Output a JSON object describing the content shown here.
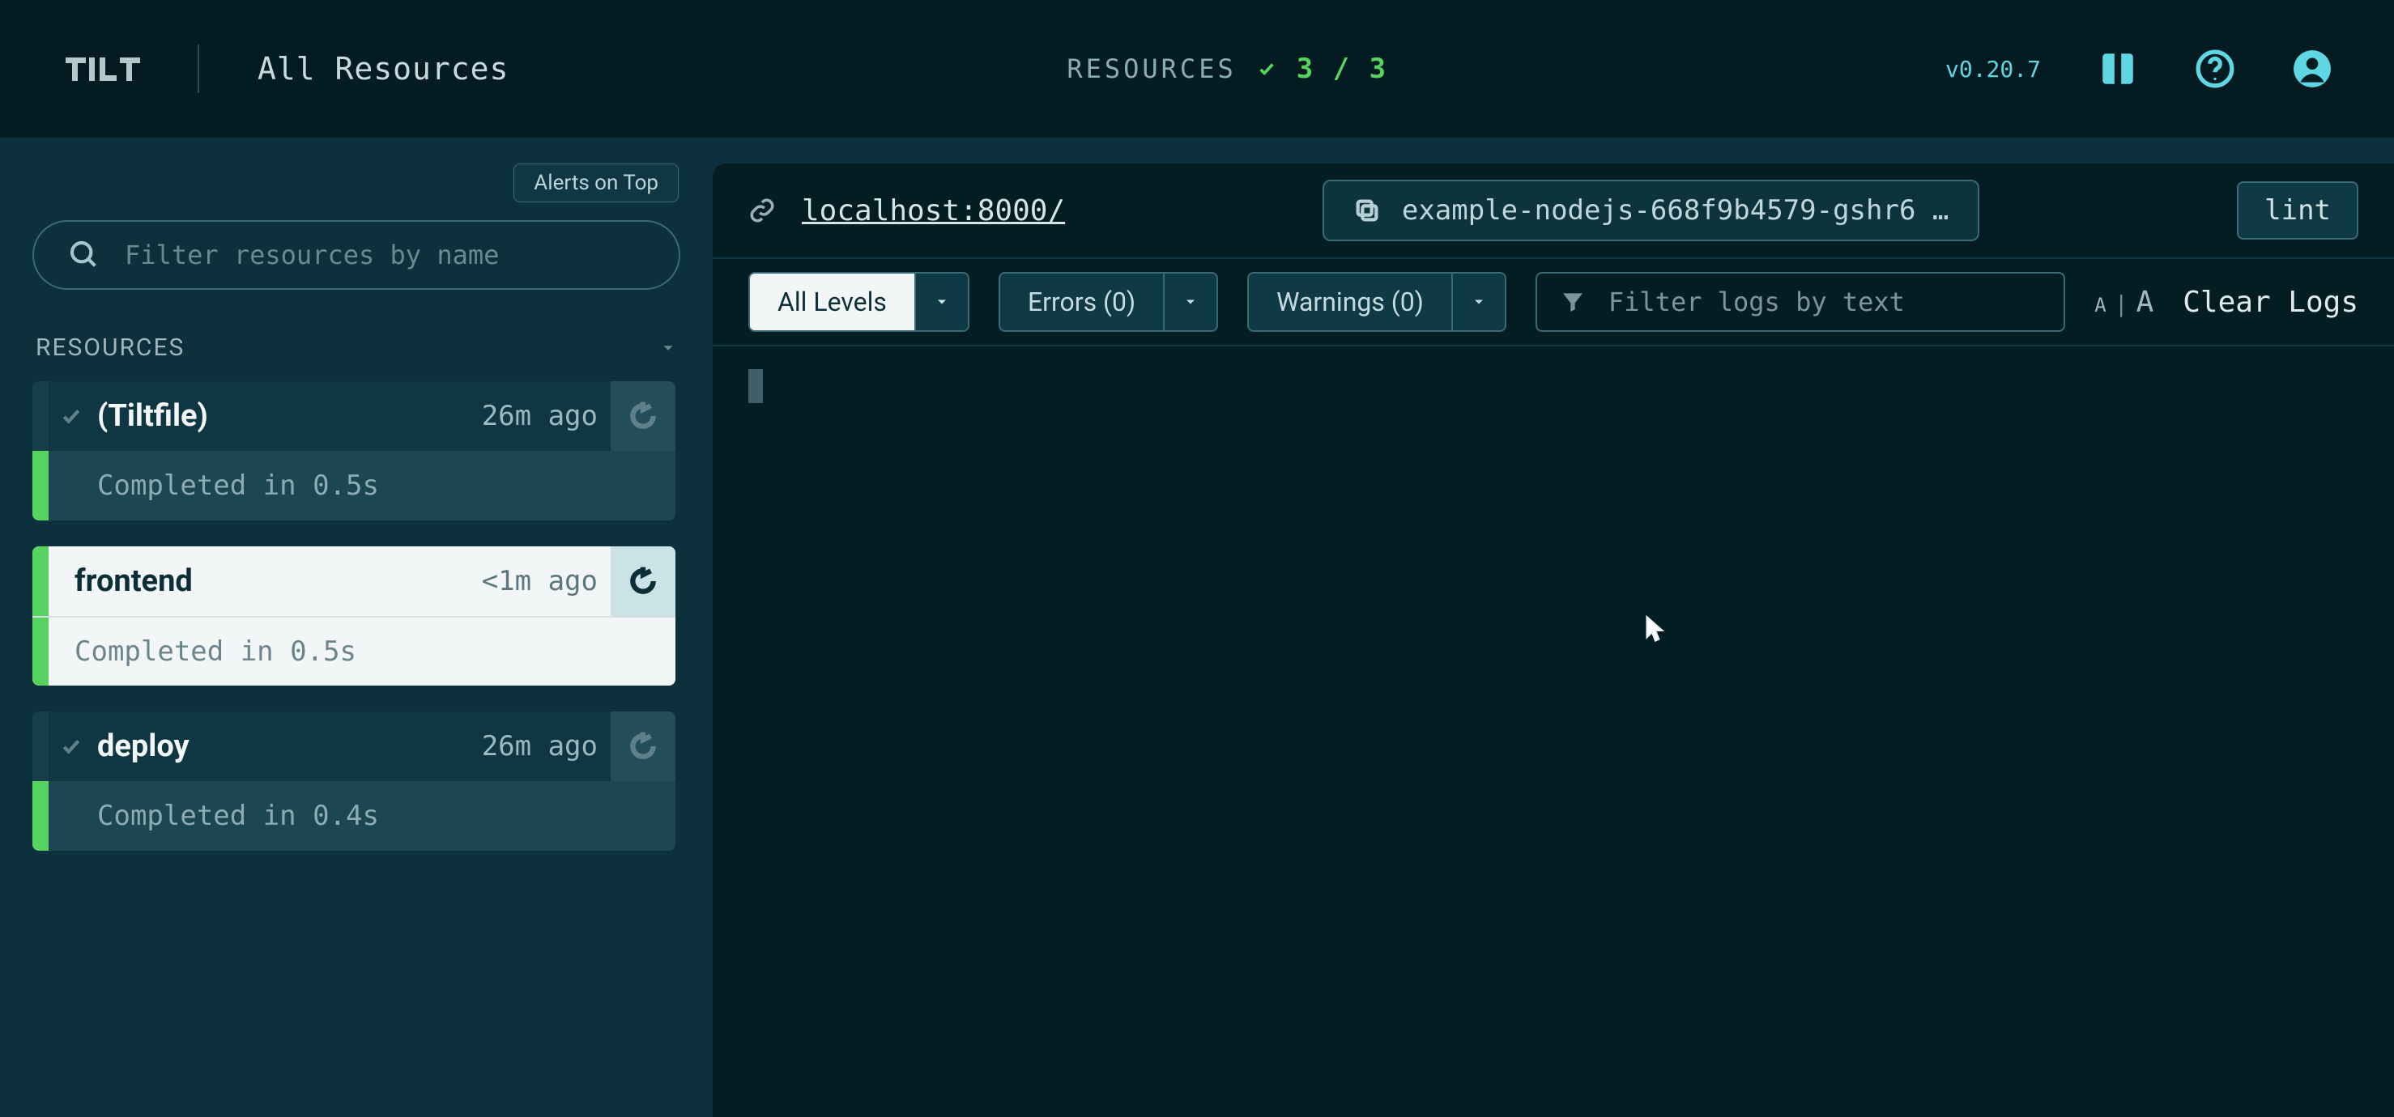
{
  "header": {
    "title": "All Resources",
    "resources_label": "RESOURCES",
    "counter": "3 / 3",
    "version": "v0.20.7"
  },
  "sidebar": {
    "alerts_toggle": "Alerts on Top",
    "filter_placeholder": "Filter resources by name",
    "section_label": "RESOURCES",
    "items": [
      {
        "name": "(Tiltfile)",
        "ago": "26m ago",
        "status": "Completed in 0.5s",
        "active": false
      },
      {
        "name": "frontend",
        "ago": "<1m ago",
        "status": "Completed in 0.5s",
        "active": true
      },
      {
        "name": "deploy",
        "ago": "26m ago",
        "status": "Completed in 0.4s",
        "active": false
      }
    ]
  },
  "main": {
    "endpoint": "localhost:8000/",
    "pod": "example-nodejs-668f9b4579-gshr6 …",
    "lint": "lint",
    "filters": {
      "all": "All Levels",
      "errors": "Errors (0)",
      "warnings": "Warnings (0)",
      "log_placeholder": "Filter logs by text"
    },
    "fontsize": {
      "small": "A",
      "large": "A",
      "sep": "|"
    },
    "clear_logs": "Clear Logs"
  }
}
